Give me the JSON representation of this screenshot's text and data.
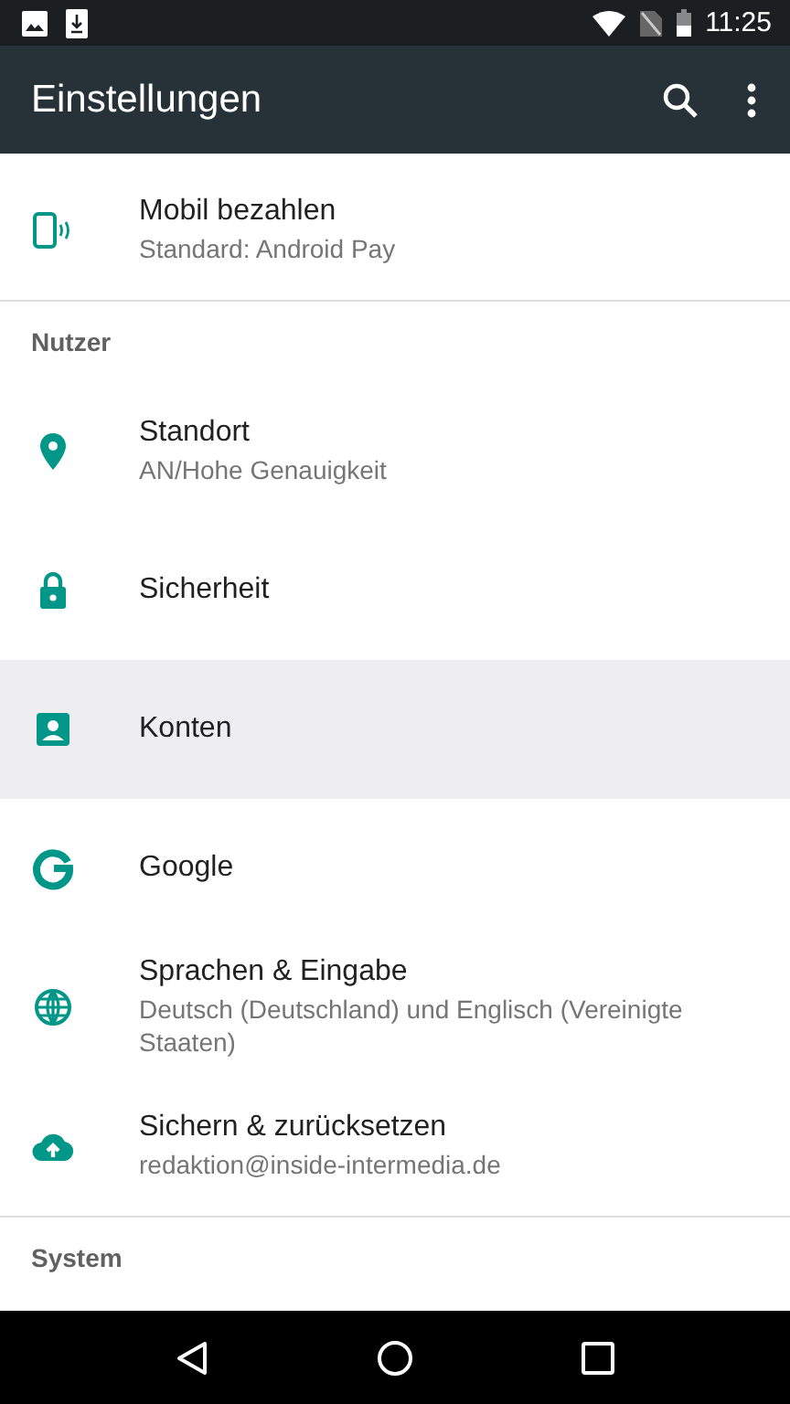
{
  "status_bar": {
    "time": "11:25"
  },
  "app_bar": {
    "title": "Einstellungen"
  },
  "list": [
    {
      "kind": "item",
      "title": "Mobil bezahlen",
      "subtitle": "Standard: Android Pay",
      "selected": false
    },
    {
      "kind": "header",
      "title": "Nutzer"
    },
    {
      "kind": "item",
      "title": "Standort",
      "subtitle": "AN/Hohe Genauigkeit",
      "selected": false
    },
    {
      "kind": "item",
      "title": "Sicherheit",
      "selected": false
    },
    {
      "kind": "item",
      "title": "Konten",
      "selected": true
    },
    {
      "kind": "item",
      "title": "Google",
      "selected": false
    },
    {
      "kind": "item",
      "title": "Sprachen & Eingabe",
      "subtitle": "Deutsch (Deutschland) und Englisch (Vereinigte Staaten)",
      "selected": false
    },
    {
      "kind": "item",
      "title": "Sichern & zurücksetzen",
      "subtitle": "redaktion@inside-intermedia.de",
      "selected": false
    },
    {
      "kind": "header",
      "title": "System"
    }
  ]
}
